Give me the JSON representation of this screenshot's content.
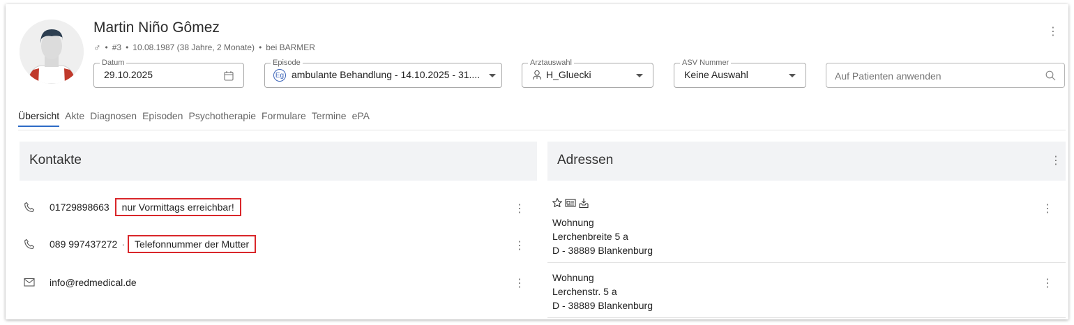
{
  "patient": {
    "name": "Martin Niño Gômez",
    "gender_symbol": "♂",
    "bullet": "•",
    "number": "#3",
    "birth": "10.08.1987 (38 Jahre, 2 Monate)",
    "insurance": "bei BARMER"
  },
  "filters": {
    "datum": {
      "label": "Datum",
      "value": "29.10.2025"
    },
    "episode": {
      "label": "Episode",
      "badge": "Eg",
      "value": "ambulante Behandlung - 14.10.2025 - 31...."
    },
    "arzt": {
      "label": "Arztauswahl",
      "value": "H_Gluecki"
    },
    "asv": {
      "label": "ASV Nummer",
      "value": "Keine Auswahl"
    },
    "search": {
      "placeholder": "Auf Patienten anwenden"
    }
  },
  "tabs": [
    "Übersicht",
    "Akte",
    "Diagnosen",
    "Episoden",
    "Psychotherapie",
    "Formulare",
    "Termine",
    "ePA"
  ],
  "contacts": {
    "title": "Kontakte",
    "items": [
      {
        "value": "01729898663",
        "note": "nur Vormittags erreichbar!"
      },
      {
        "value": "089 997437272",
        "sep": "·",
        "note": "Telefonnummer der Mutter"
      },
      {
        "value": "info@redmedical.de"
      }
    ]
  },
  "addresses": {
    "title": "Adressen",
    "items": [
      {
        "type": "Wohnung",
        "street": "Lerchenbreite 5 a",
        "city": "D - 38889 Blankenburg"
      },
      {
        "type": "Wohnung",
        "street": "Lerchenstr. 5 a",
        "city": "D - 38889 Blankenburg"
      }
    ]
  },
  "menu_glyph": "⋮"
}
